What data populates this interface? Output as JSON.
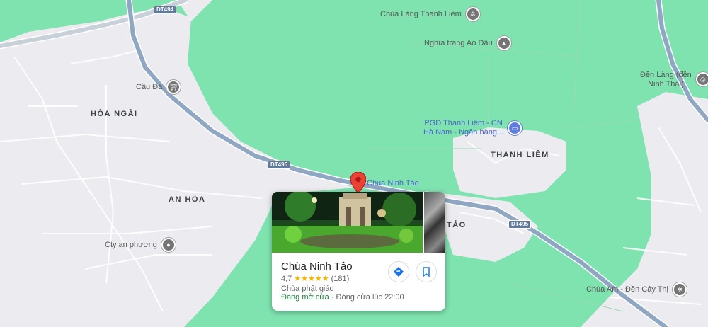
{
  "map": {
    "colors": {
      "green": "#7fe3b0",
      "urban": "#ececf0",
      "road": "#8fa7c2",
      "minor_road": "#ffffff"
    },
    "areas": [
      "HÒA NGÃI",
      "AN HÒA",
      "THANH LIÊM",
      "TẢO"
    ],
    "road_shields": [
      "DT494",
      "DT495",
      "DT495"
    ],
    "pois": [
      {
        "label": "Chùa Làng Thanh Liêm",
        "icon": "temple-icon"
      },
      {
        "label": "Nghĩa trang Ao Dâu",
        "icon": "cemetery-icon"
      },
      {
        "label": "Cầu Đá",
        "icon": "bridge-icon"
      },
      {
        "label": "Đền Làng (đền",
        "label2": "Ninh Thái)",
        "icon": "shrine-icon"
      },
      {
        "label": "PGD Thanh Liêm - CN",
        "label2": "Hà Nam - Ngân hàng...",
        "icon": "bank-icon"
      },
      {
        "label": "Cty an phương",
        "icon": "pin-icon"
      },
      {
        "label": "Chùa Am - Đền Cây Thị",
        "icon": "temple-icon"
      },
      {
        "label": "Chùa Ninh Tảo",
        "icon": "red-pin-icon"
      }
    ]
  },
  "card": {
    "title": "Chùa Ninh Tảo",
    "rating": "4,7",
    "stars": "★★★★★",
    "reviews": "(181)",
    "category": "Chùa phật giáo",
    "open_status": "Đang mở cửa",
    "closing": " · Đóng cửa lúc 22:00",
    "directions_icon": "directions-icon",
    "save_icon": "bookmark-icon"
  }
}
